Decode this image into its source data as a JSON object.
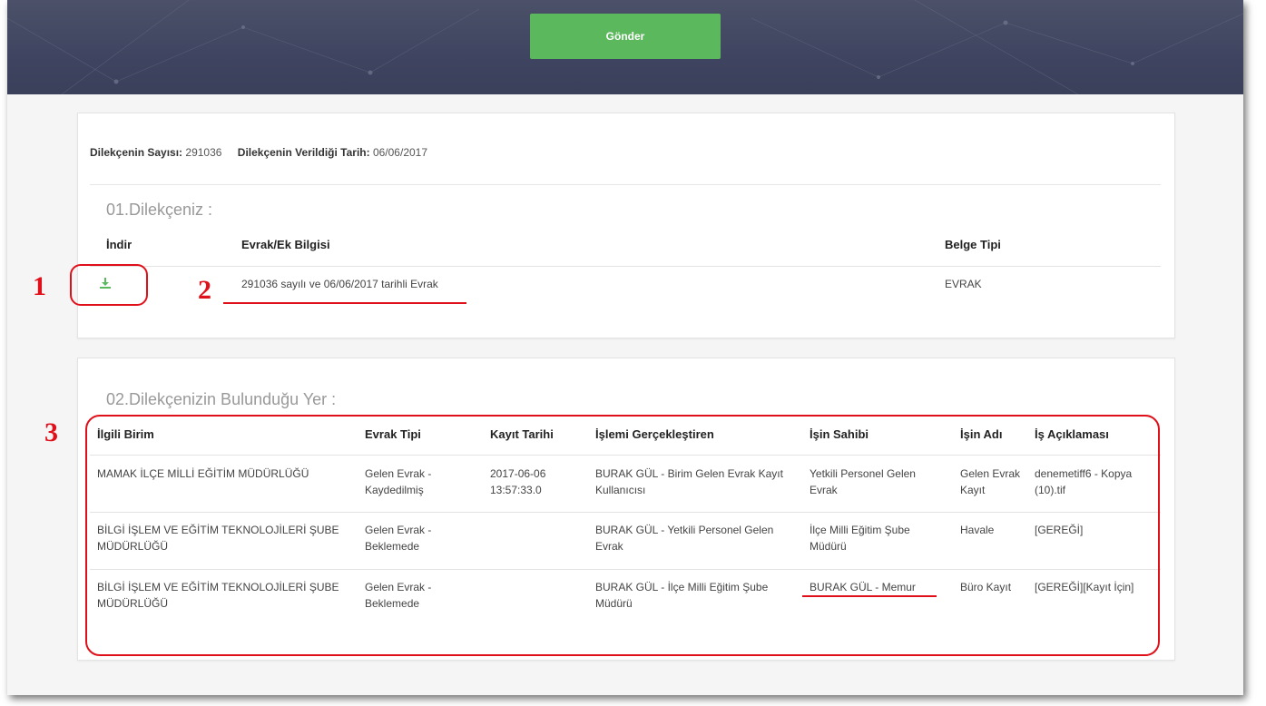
{
  "header": {
    "send_label": "Gönder"
  },
  "petition_info": {
    "number_label": "Dilekçenin Sayısı:",
    "number_value": "291036",
    "date_label": "Dilekçenin Verildiği Tarih:",
    "date_value": "06/06/2017"
  },
  "section1": {
    "title": "01.Dilekçeniz :",
    "columns": [
      "İndir",
      "Evrak/Ek Bilgisi",
      "Belge Tipi"
    ],
    "row": {
      "download_icon": "download-icon",
      "info": "291036 sayılı ve 06/06/2017 tarihli Evrak",
      "type": "EVRAK"
    }
  },
  "section2": {
    "title": "02.Dilekçenizin Bulunduğu Yer :",
    "columns": [
      "İlgili Birim",
      "Evrak Tipi",
      "Kayıt Tarihi",
      "İşlemi Gerçekleştiren",
      "İşin Sahibi",
      "İşin Adı",
      "İş Açıklaması"
    ],
    "rows": [
      {
        "unit": "MAMAK İLÇE MİLLİ EĞİTİM MÜDÜRLÜĞÜ",
        "doc_type": "Gelen Evrak - Kaydedilmiş",
        "date": "2017-06-06 13:57:33.0",
        "performer": "BURAK GÜL - Birim Gelen Evrak Kayıt Kullanıcısı",
        "owner": "Yetkili Personel Gelen Evrak",
        "job": "Gelen Evrak Kayıt",
        "desc": "denemetiff6 - Kopya (10).tif"
      },
      {
        "unit": "BİLGİ İŞLEM VE EĞİTİM TEKNOLOJİLERİ ŞUBE MÜDÜRLÜĞÜ",
        "doc_type": "Gelen Evrak - Beklemede",
        "date": "",
        "performer": "BURAK GÜL - Yetkili Personel Gelen Evrak",
        "owner": "İlçe Milli Eğitim Şube Müdürü",
        "job": "Havale",
        "desc": "[GEREĞİ]"
      },
      {
        "unit": "BİLGİ İŞLEM VE EĞİTİM TEKNOLOJİLERİ ŞUBE MÜDÜRLÜĞÜ",
        "doc_type": "Gelen Evrak - Beklemede",
        "date": "",
        "performer": "BURAK GÜL - İlçe Milli Eğitim Şube Müdürü",
        "owner": "BURAK GÜL - Memur",
        "job": "Büro Kayıt",
        "desc": "[GEREĞİ][Kayıt İçin]"
      }
    ]
  },
  "annotations": [
    "1",
    "2",
    "3"
  ],
  "colors": {
    "accent_green": "#5cb85c",
    "annotation_red": "#e0101a",
    "header_bg": "#434862"
  }
}
